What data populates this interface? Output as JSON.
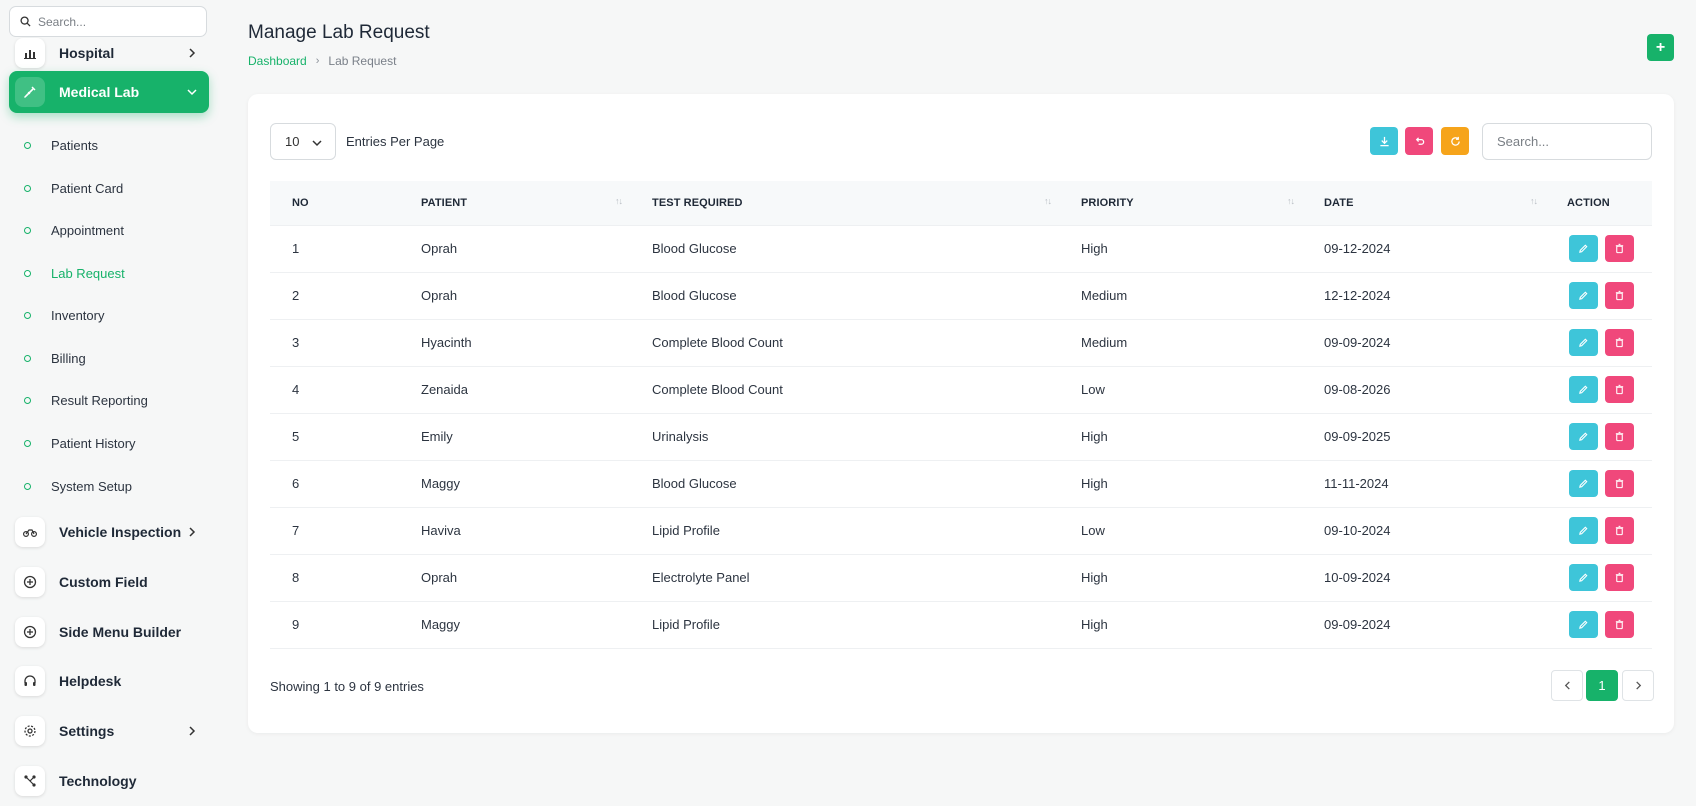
{
  "sidebar": {
    "search_placeholder": "Search...",
    "items_top": [
      {
        "label": "Hospital",
        "icon": "bar-chart-icon"
      },
      {
        "label": "Medical Lab",
        "icon": "syringe-icon",
        "active": true
      }
    ],
    "sub_items": [
      {
        "label": "Patients"
      },
      {
        "label": "Patient Card"
      },
      {
        "label": "Appointment"
      },
      {
        "label": "Lab Request",
        "active": true
      },
      {
        "label": "Inventory"
      },
      {
        "label": "Billing"
      },
      {
        "label": "Result Reporting"
      },
      {
        "label": "Patient History"
      },
      {
        "label": "System Setup"
      }
    ],
    "items_bottom": [
      {
        "label": "Vehicle Inspection",
        "icon": "motorcycle-icon"
      },
      {
        "label": "Custom Field",
        "icon": "plus-circle-icon"
      },
      {
        "label": "Side Menu Builder",
        "icon": "plus-circle-icon"
      },
      {
        "label": "Helpdesk",
        "icon": "headphones-icon"
      },
      {
        "label": "Settings",
        "icon": "gear-icon"
      },
      {
        "label": "Technology",
        "icon": "network-icon"
      }
    ]
  },
  "header": {
    "title": "Manage Lab Request",
    "breadcrumb": [
      "Dashboard",
      "Lab Request"
    ],
    "add_label": "+"
  },
  "table_controls": {
    "entries_value": "10",
    "entries_label": "Entries Per Page",
    "search_placeholder": "Search..."
  },
  "table": {
    "columns": [
      "NO",
      "PATIENT",
      "TEST REQUIRED",
      "PRIORITY",
      "DATE",
      "ACTION"
    ],
    "sort_glyph": "↑↓",
    "rows": [
      {
        "no": "1",
        "patient": "Oprah",
        "test": "Blood Glucose",
        "priority": "High",
        "date": "09-12-2024"
      },
      {
        "no": "2",
        "patient": "Oprah",
        "test": "Blood Glucose",
        "priority": "Medium",
        "date": "12-12-2024"
      },
      {
        "no": "3",
        "patient": "Hyacinth",
        "test": "Complete Blood Count",
        "priority": "Medium",
        "date": "09-09-2024"
      },
      {
        "no": "4",
        "patient": "Zenaida",
        "test": "Complete Blood Count",
        "priority": "Low",
        "date": "09-08-2026"
      },
      {
        "no": "5",
        "patient": "Emily",
        "test": "Urinalysis",
        "priority": "High",
        "date": "09-09-2025"
      },
      {
        "no": "6",
        "patient": "Maggy",
        "test": "Blood Glucose",
        "priority": "High",
        "date": "11-11-2024"
      },
      {
        "no": "7",
        "patient": "Haviva",
        "test": "Lipid Profile",
        "priority": "Low",
        "date": "09-10-2024"
      },
      {
        "no": "8",
        "patient": "Oprah",
        "test": "Electrolyte Panel",
        "priority": "High",
        "date": "10-09-2024"
      },
      {
        "no": "9",
        "patient": "Maggy",
        "test": "Lipid Profile",
        "priority": "High",
        "date": "09-09-2024"
      }
    ]
  },
  "footer": {
    "info": "Showing 1 to 9 of 9 entries",
    "current_page": "1"
  },
  "colors": {
    "accent": "#17b26a",
    "edit": "#3ec5d9",
    "delete": "#f0487b",
    "refresh": "#f6a41b"
  }
}
